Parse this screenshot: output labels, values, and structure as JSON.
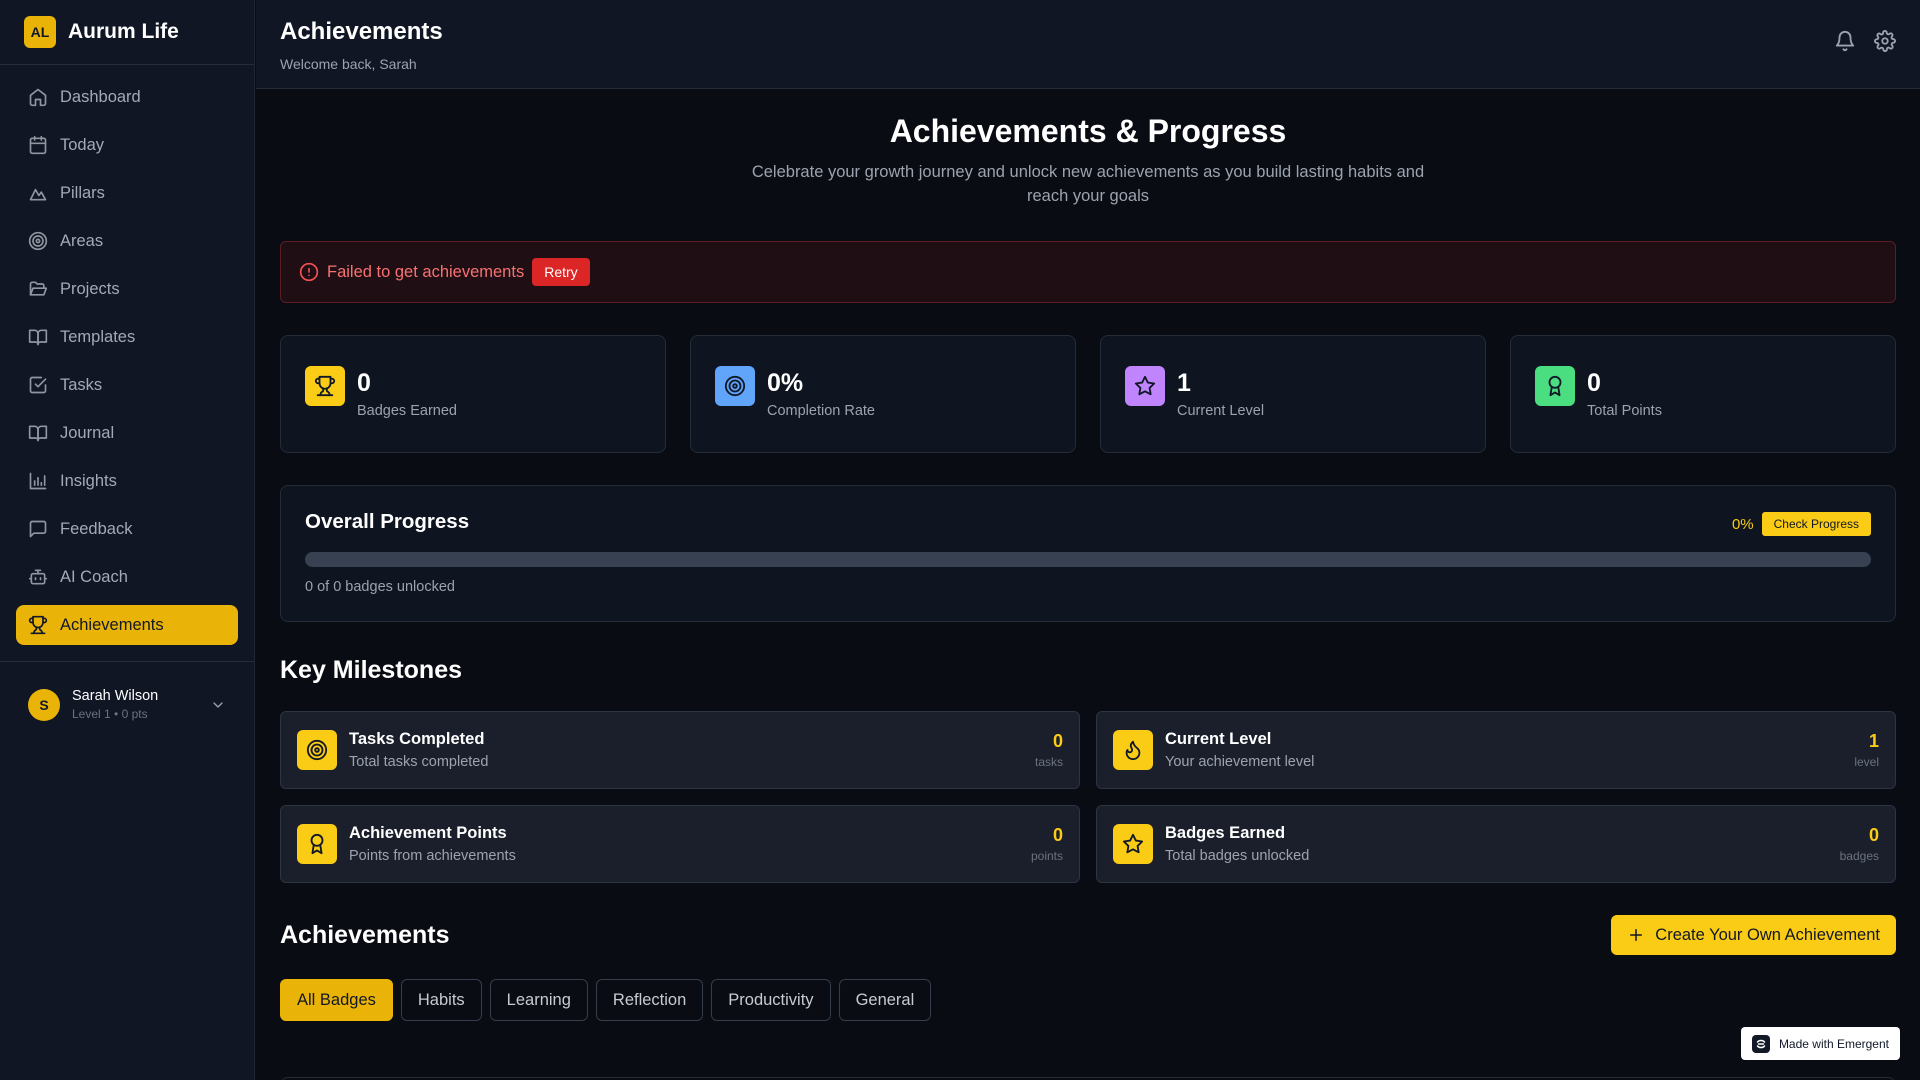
{
  "brand": {
    "logo": "AL",
    "name": "Aurum Life"
  },
  "colors": {
    "accent": "#eab308",
    "danger": "#dc2626",
    "blue": "#60a5fa",
    "purple": "#c084fc",
    "green": "#4ade80"
  },
  "sidebar": {
    "items": [
      {
        "label": "Dashboard",
        "icon": "home-icon"
      },
      {
        "label": "Today",
        "icon": "calendar-icon"
      },
      {
        "label": "Pillars",
        "icon": "mountain-icon"
      },
      {
        "label": "Areas",
        "icon": "target-icon"
      },
      {
        "label": "Projects",
        "icon": "folder-open-icon"
      },
      {
        "label": "Templates",
        "icon": "book-open-icon"
      },
      {
        "label": "Tasks",
        "icon": "check-square-icon"
      },
      {
        "label": "Journal",
        "icon": "book-open-icon"
      },
      {
        "label": "Insights",
        "icon": "bar-chart-icon"
      },
      {
        "label": "Feedback",
        "icon": "message-icon"
      },
      {
        "label": "AI Coach",
        "icon": "bot-icon"
      },
      {
        "label": "Achievements",
        "icon": "trophy-icon",
        "active": true
      }
    ]
  },
  "user": {
    "initial": "S",
    "name": "Sarah Wilson",
    "meta": "Level 1 • 0 pts"
  },
  "header": {
    "title": "Achievements",
    "subtitle": "Welcome back, Sarah"
  },
  "hero": {
    "title": "Achievements & Progress",
    "subtitle": "Celebrate your growth journey and unlock new achievements as you build lasting habits and reach your goals"
  },
  "error": {
    "message": "Failed to get achievements",
    "retry_label": "Retry"
  },
  "stats": [
    {
      "value": "0",
      "label": "Badges Earned",
      "icon": "trophy-icon",
      "color": "#facc15"
    },
    {
      "value": "0%",
      "label": "Completion Rate",
      "icon": "target-icon",
      "color": "#60a5fa"
    },
    {
      "value": "1",
      "label": "Current Level",
      "icon": "star-icon",
      "color": "#c084fc"
    },
    {
      "value": "0",
      "label": "Total Points",
      "icon": "award-icon",
      "color": "#4ade80"
    }
  ],
  "progress": {
    "title": "Overall Progress",
    "percent_text": "0%",
    "percent": 0,
    "check_label": "Check Progress",
    "caption": "0 of 0 badges unlocked"
  },
  "milestones": {
    "title": "Key Milestones",
    "items": [
      {
        "title": "Tasks Completed",
        "subtitle": "Total tasks completed",
        "value": "0",
        "unit": "tasks",
        "icon": "target-icon"
      },
      {
        "title": "Current Level",
        "subtitle": "Your achievement level",
        "value": "1",
        "unit": "level",
        "icon": "flame-icon"
      },
      {
        "title": "Achievement Points",
        "subtitle": "Points from achievements",
        "value": "0",
        "unit": "points",
        "icon": "award-icon"
      },
      {
        "title": "Badges Earned",
        "subtitle": "Total badges unlocked",
        "value": "0",
        "unit": "badges",
        "icon": "star-icon"
      }
    ]
  },
  "achievements": {
    "title": "Achievements",
    "create_label": "Create Your Own Achievement",
    "tabs": [
      "All Badges",
      "Habits",
      "Learning",
      "Reflection",
      "Productivity",
      "General"
    ],
    "active_tab": 0
  },
  "footer_badge": {
    "label": "Made with Emergent"
  }
}
